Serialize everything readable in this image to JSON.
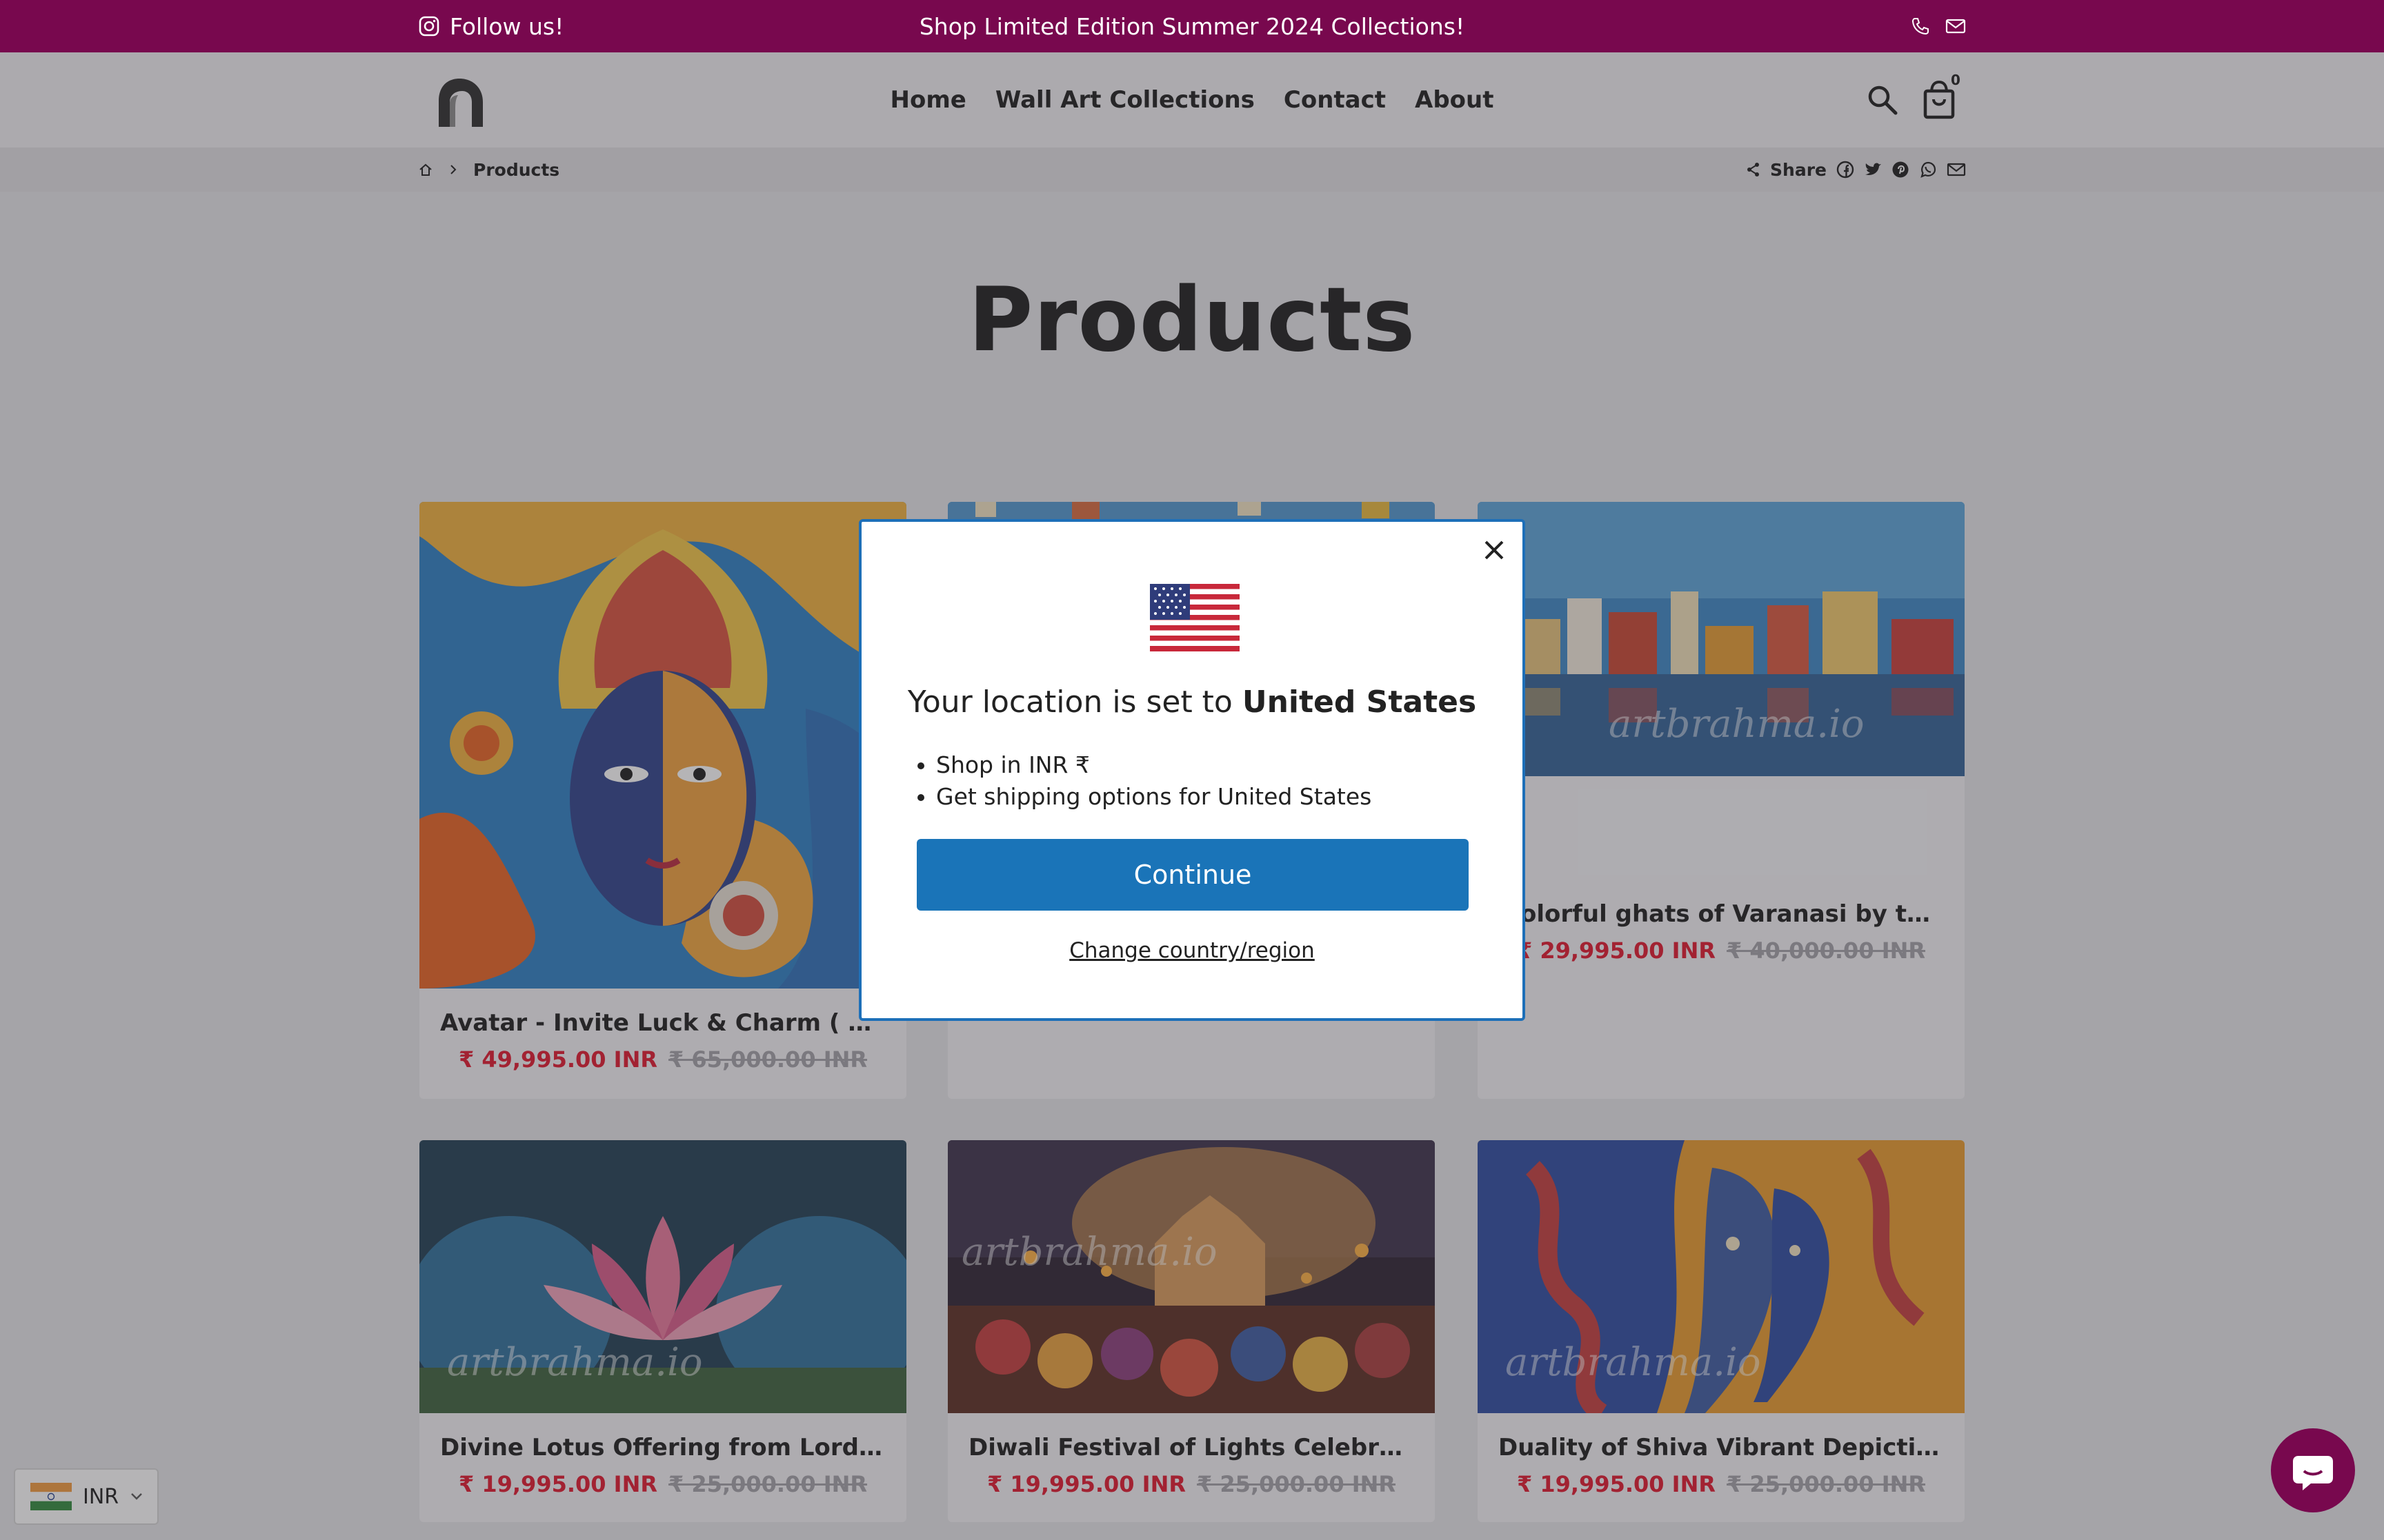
{
  "announcement": {
    "follow_label": "Follow us!",
    "message": "Shop Limited Edition Summer 2024 Collections!"
  },
  "header": {
    "nav": [
      "Home",
      "Wall Art Collections",
      "Contact",
      "About"
    ],
    "cart_count": "0"
  },
  "breadcrumb": {
    "current": "Products",
    "share_label": "Share"
  },
  "page": {
    "title": "Products"
  },
  "products": [
    {
      "title": "Avatar - Invite Luck & Charm ( XL Ca...",
      "price": "₹ 49,995.00 INR",
      "compare": "₹ 65,000.00 INR"
    },
    {
      "title": "",
      "price": "",
      "compare": ""
    },
    {
      "title": "olorful ghats of Varanasi by the ser...",
      "price": "₹ 29,995.00 INR",
      "compare": "₹ 40,000.00 INR",
      "watermark": "artbrahma.io"
    },
    {
      "title": "Divine Lotus Offering from Lord Krish...",
      "price": "₹ 19,995.00 INR",
      "compare": "₹ 25,000.00 INR",
      "watermark": "artbrahma.io"
    },
    {
      "title": "Diwali Festival of Lights Celebration ...",
      "price": "₹ 19,995.00 INR",
      "compare": "₹ 25,000.00 INR",
      "watermark": "artbrahma.io"
    },
    {
      "title": "Duality of Shiva Vibrant Depiction of ...",
      "price": "₹ 19,995.00 INR",
      "compare": "₹ 25,000.00 INR",
      "watermark": "artbrahma.io"
    }
  ],
  "modal": {
    "heading_prefix": "Your location is set to",
    "country": "United States",
    "bullets": [
      "Shop in INR ₹",
      "Get shipping options for United States"
    ],
    "continue_label": "Continue",
    "change_label": "Change country/region"
  },
  "currency": {
    "code": "INR"
  },
  "colors": {
    "announcement_bg": "#78084e",
    "sale_price": "#e1142b",
    "continue_button": "#1a74b8",
    "modal_border": "#1d6fb8"
  },
  "icons": [
    "instagram-icon",
    "phone-icon",
    "mail-icon",
    "search-icon",
    "cart-icon",
    "home-icon",
    "chevron-right-icon",
    "share-icon",
    "facebook-icon",
    "twitter-icon",
    "pinterest-icon",
    "whatsapp-icon",
    "email-icon",
    "close-icon",
    "us-flag-icon",
    "india-flag-icon",
    "chevron-down-icon",
    "chat-icon"
  ]
}
